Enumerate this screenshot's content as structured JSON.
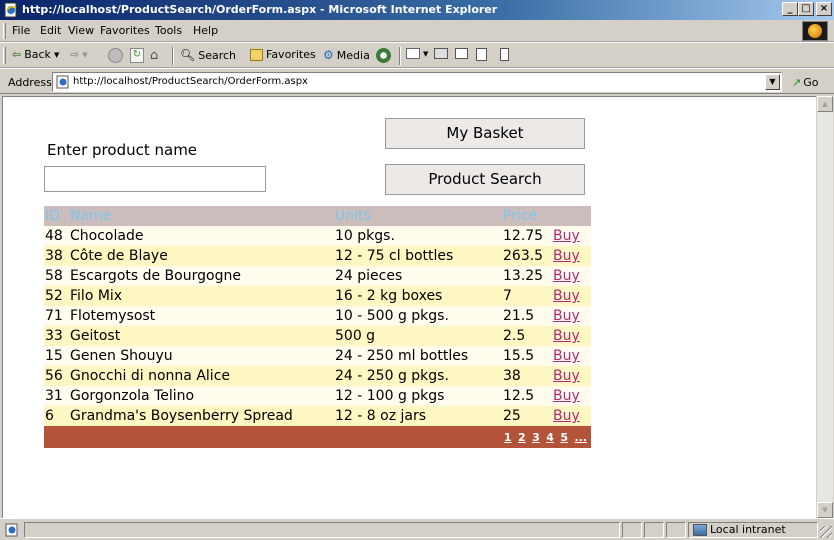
{
  "window": {
    "title": "http://localhost/ProductSearch/OrderForm.aspx - Microsoft Internet Explorer",
    "minimize_glyph": "_",
    "maximize_glyph": "□",
    "close_glyph": "×"
  },
  "menu": {
    "items": [
      "File",
      "Edit",
      "View",
      "Favorites",
      "Tools",
      "Help"
    ]
  },
  "toolbar": {
    "back_label": "Back",
    "search_label": "Search",
    "favorites_label": "Favorites",
    "media_label": "Media"
  },
  "address": {
    "label": "Address",
    "url": "http://localhost/ProductSearch/OrderForm.aspx",
    "go_label": "Go"
  },
  "page": {
    "enter_label": "Enter product name",
    "search_value": "",
    "basket_button": "My Basket",
    "search_button": "Product Search",
    "grid": {
      "headers": [
        "ID",
        "Name",
        "Units",
        "Price",
        ""
      ],
      "rows": [
        {
          "id": "48",
          "name": "Chocolade",
          "units": "10 pkgs.",
          "price": "12.75",
          "action": "Buy"
        },
        {
          "id": "38",
          "name": "Côte de Blaye",
          "units": "12 - 75 cl bottles",
          "price": "263.5",
          "action": "Buy"
        },
        {
          "id": "58",
          "name": "Escargots de Bourgogne",
          "units": "24 pieces",
          "price": "13.25",
          "action": "Buy"
        },
        {
          "id": "52",
          "name": "Filo Mix",
          "units": "16 - 2 kg boxes",
          "price": "7",
          "action": "Buy"
        },
        {
          "id": "71",
          "name": "Flotemysost",
          "units": "10 - 500 g pkgs.",
          "price": "21.5",
          "action": "Buy"
        },
        {
          "id": "33",
          "name": "Geitost",
          "units": "500 g",
          "price": "2.5",
          "action": "Buy"
        },
        {
          "id": "15",
          "name": "Genen Shouyu",
          "units": "24 - 250 ml bottles",
          "price": "15.5",
          "action": "Buy"
        },
        {
          "id": "56",
          "name": "Gnocchi di nonna Alice",
          "units": "24 - 250 g pkgs.",
          "price": "38",
          "action": "Buy"
        },
        {
          "id": "31",
          "name": "Gorgonzola Telino",
          "units": "12 - 100 g pkgs",
          "price": "12.5",
          "action": "Buy"
        },
        {
          "id": "6",
          "name": "Grandma's Boysenberry Spread",
          "units": "12 - 8 oz jars",
          "price": "25",
          "action": "Buy"
        }
      ],
      "pager": [
        "1",
        "2",
        "3",
        "4",
        "5",
        "..."
      ]
    }
  },
  "status": {
    "zone_label": "Local intranet"
  },
  "colors": {
    "header_bg": "#ccbdbd",
    "header_text": "#7ec5ee",
    "row_odd": "#fffcee",
    "row_even": "#fff7c2",
    "pager_bg": "#b3533a",
    "buy_link": "#b0287a"
  }
}
